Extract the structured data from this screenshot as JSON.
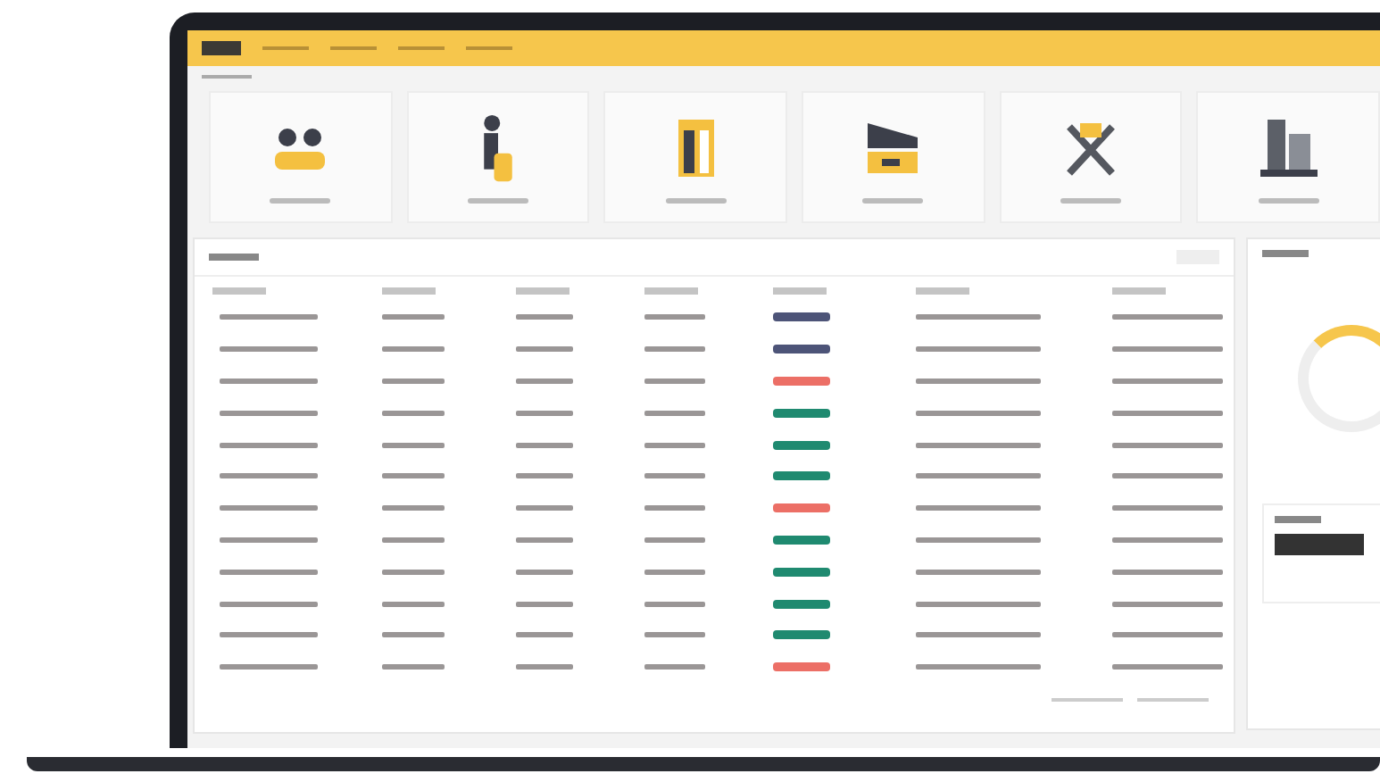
{
  "tiles": [
    {
      "kind": "group"
    },
    {
      "kind": "person"
    },
    {
      "kind": "door"
    },
    {
      "kind": "vehicle"
    },
    {
      "kind": "tools"
    },
    {
      "kind": "machine"
    }
  ],
  "table": {
    "rows": [
      {
        "color": "#4d5478"
      },
      {
        "color": "#4d5478"
      },
      {
        "color": "#ec6f66"
      },
      {
        "color": "#1f8a70"
      },
      {
        "color": "#1f8a70"
      },
      {
        "color": "#1f8a70"
      },
      {
        "color": "#ec6f66"
      },
      {
        "color": "#1f8a70"
      },
      {
        "color": "#1f8a70"
      },
      {
        "color": "#1f8a70"
      },
      {
        "color": "#1f8a70"
      },
      {
        "color": "#ec6f66"
      }
    ]
  }
}
